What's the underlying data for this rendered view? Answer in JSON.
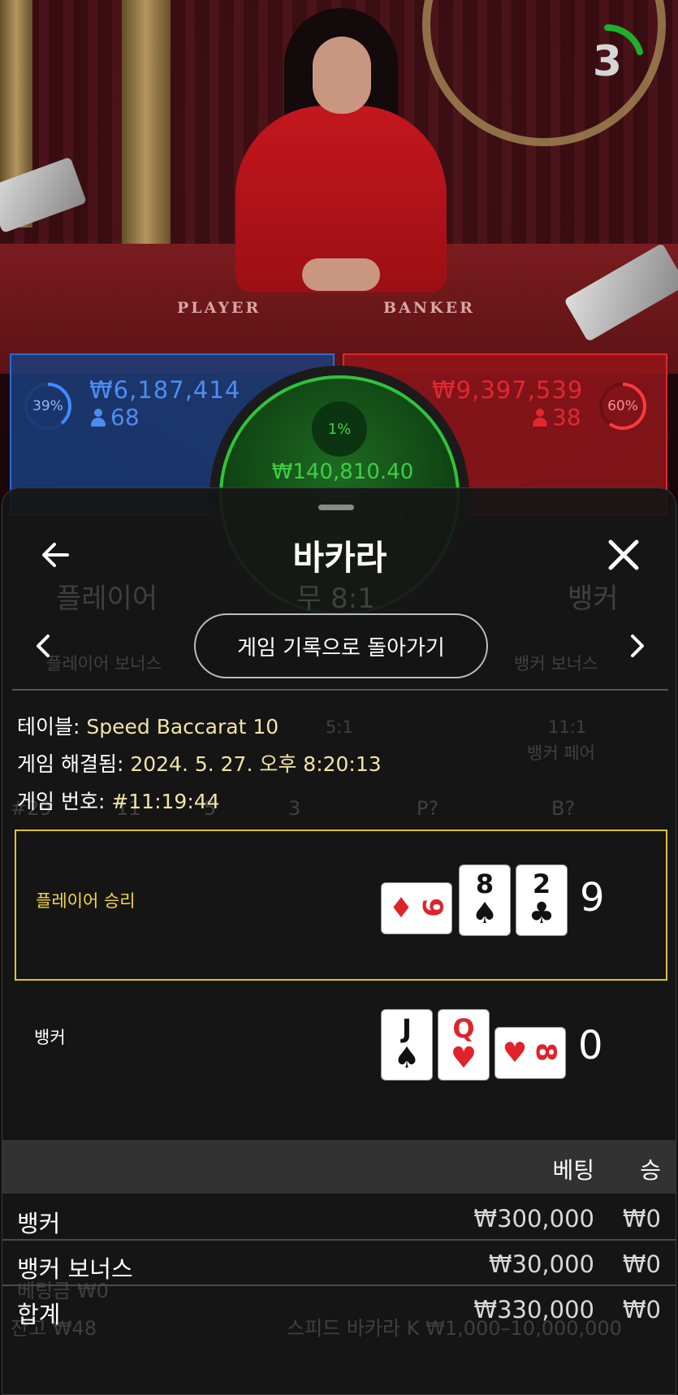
{
  "video": {
    "countdown": "3",
    "table_labels": {
      "player": "PLAYER",
      "banker": "BANKER"
    }
  },
  "bet_spots": {
    "player": {
      "percent": "39%",
      "percent_value": 0.39,
      "amount": "₩6,187,414",
      "players": "68",
      "color": "#2b6bd6"
    },
    "banker": {
      "percent": "60%",
      "percent_value": 0.6,
      "amount": "₩9,397,539",
      "players": "38",
      "color": "#e0282f"
    },
    "tie": {
      "percent": "1%",
      "percent_value": 0.01,
      "amount": "₩140,810.40",
      "color": "#2fc43a"
    }
  },
  "background_ghost": {
    "player_label": "플레이어",
    "tie_label": "무 8:1",
    "banker_label": "뱅커",
    "player_bonus": "플레이어 보너스",
    "banker_bonus": "뱅커 보너스",
    "payout_5": "5:1",
    "payout_11": "11:1",
    "banker_pair": "뱅커 페어",
    "stats_count": "#29",
    "p_count": "11",
    "b_count": "5",
    "t_count": "3",
    "p_q": "P?",
    "b_q": "B?",
    "balance_label": "잔고 ₩48",
    "bet_label": "베팅금 ₩0",
    "table_limit": "스피드 바카라 K  ₩1,000–10,000,000"
  },
  "panel": {
    "title": "바카라",
    "back_icon": "arrow-left-icon",
    "close_icon": "close-icon",
    "history_button": "게임 기록으로 돌아가기",
    "info": {
      "table_key": "테이블:",
      "table_value": "Speed Baccarat 10",
      "resolved_key": "게임 해결됨:",
      "resolved_value": "2024. 5. 27. 오후 8:20:13",
      "game_no_key": "게임 번호:",
      "game_no_value": "#11:19:44"
    },
    "result": {
      "player": {
        "label": "플레이어 승리",
        "label_color": "#f5d742",
        "total": "9",
        "cards": [
          {
            "rank": "9",
            "suit": "♦",
            "color": "red",
            "orientation": "sideways"
          },
          {
            "rank": "8",
            "suit": "♠",
            "color": "black",
            "orientation": "upright"
          },
          {
            "rank": "2",
            "suit": "♣",
            "color": "black",
            "orientation": "upright"
          }
        ]
      },
      "banker": {
        "label": "뱅커",
        "label_color": "#ffffff",
        "total": "0",
        "cards": [
          {
            "rank": "J",
            "suit": "♠",
            "color": "black",
            "orientation": "upright"
          },
          {
            "rank": "Q",
            "suit": "♥",
            "color": "red",
            "orientation": "upright"
          },
          {
            "rank": "8",
            "suit": "♥",
            "color": "red",
            "orientation": "sideways"
          }
        ]
      }
    },
    "bets": {
      "headers": {
        "bet": "베팅",
        "win": "승"
      },
      "rows": [
        {
          "name": "뱅커",
          "bet": "₩300,000",
          "win": "₩0"
        },
        {
          "name": "뱅커 보너스",
          "bet": "₩30,000",
          "win": "₩0"
        },
        {
          "name": "합계",
          "bet": "₩330,000",
          "win": "₩0"
        }
      ]
    }
  }
}
